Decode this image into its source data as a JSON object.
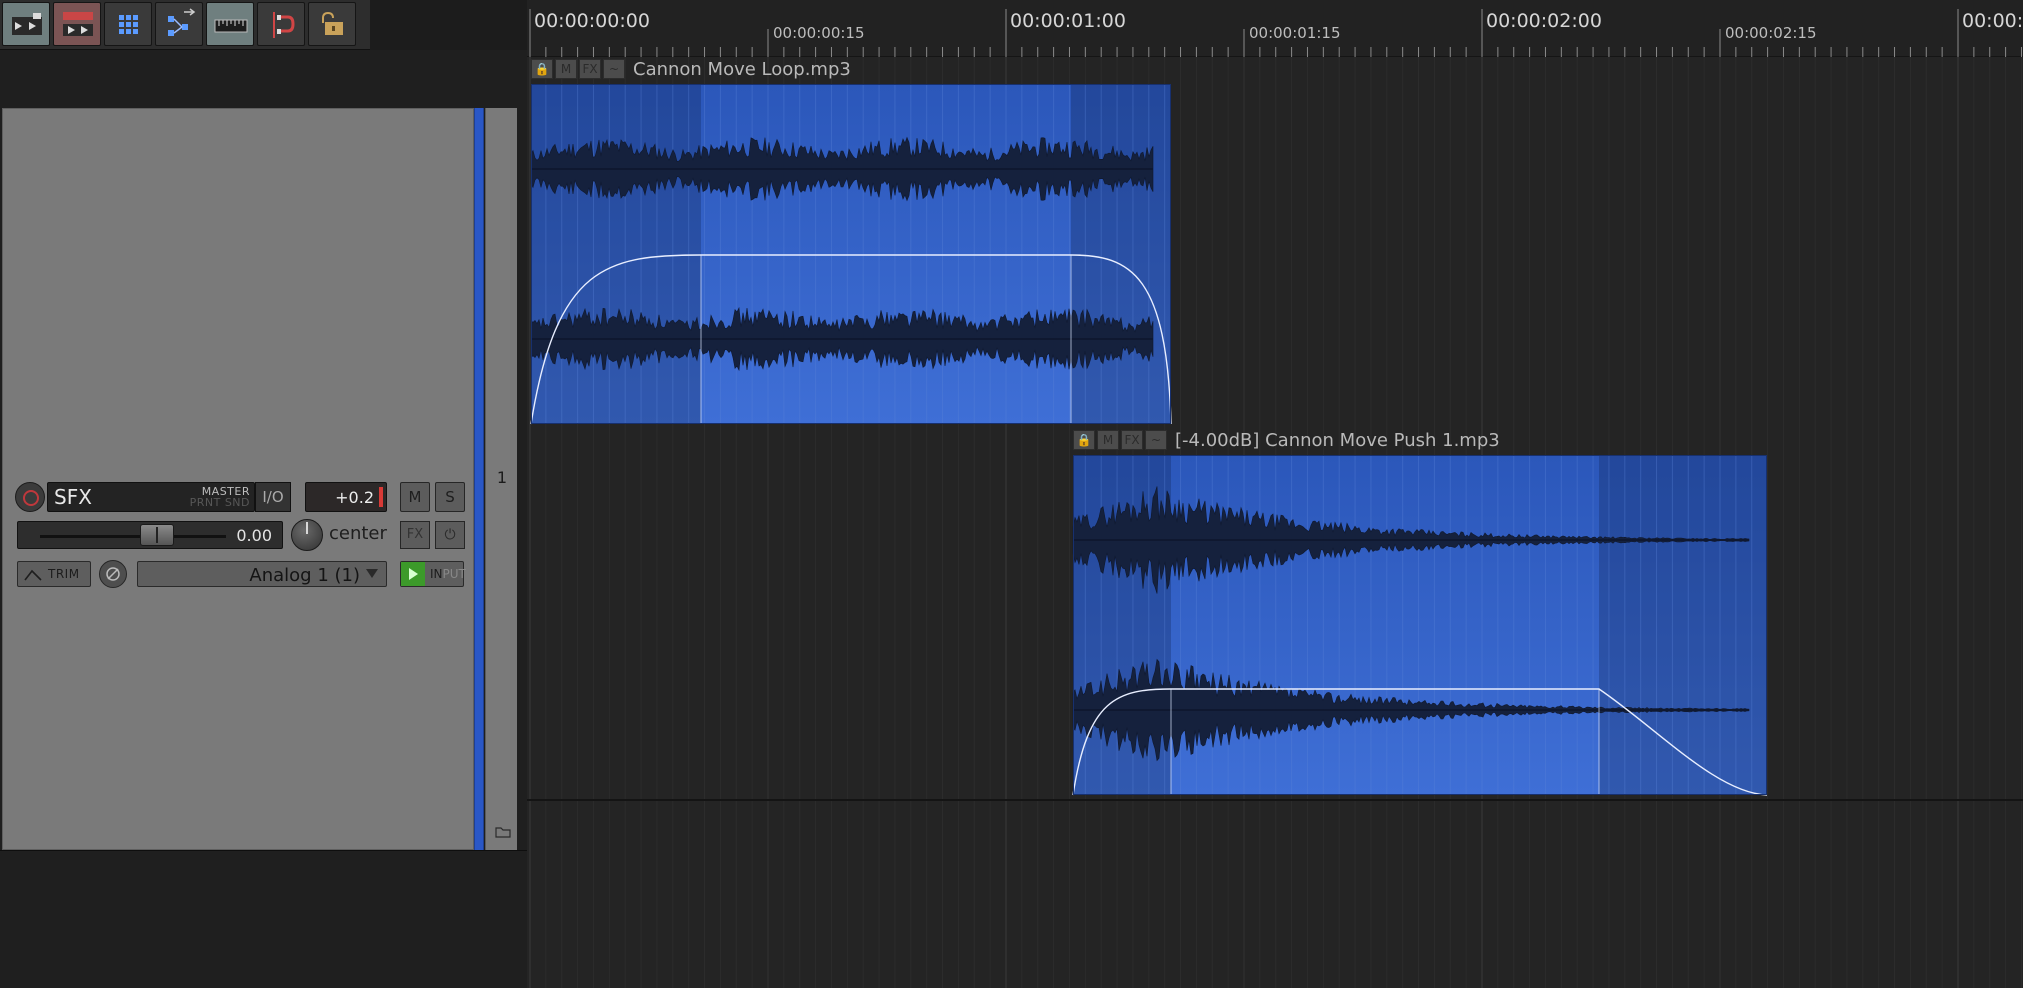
{
  "toolbar": {
    "buttons": [
      {
        "name": "auto-crossfade-button",
        "active": true
      },
      {
        "name": "ripple-edit-button",
        "active": true
      },
      {
        "name": "grid-button",
        "active": false
      },
      {
        "name": "routing-matrix-button",
        "active": false
      },
      {
        "name": "envelope-lock-button",
        "active": true
      },
      {
        "name": "snap-button",
        "active": false
      },
      {
        "name": "locking-button",
        "active": false
      }
    ]
  },
  "track": {
    "number": "1",
    "name": "SFX",
    "master_send_label": "MASTER",
    "master_send_sub": "PRNT SND",
    "io_label": "I/O",
    "volume_readout": "+0.2",
    "mute_label": "M",
    "solo_label": "S",
    "fader_value": "0.00",
    "pan_label": "center",
    "fx_label": "FX",
    "fx_bypass_label": "⏻",
    "trim_label": "TRIM",
    "input_label": "Analog 1 (1)",
    "monitor_label_on": "IN",
    "monitor_label_off": "PUT",
    "color": "#2a57c6"
  },
  "ruler": {
    "major_labels": [
      "00:00:00:00",
      "00:00:01:00",
      "00:00:02:00",
      "00:00:"
    ],
    "minor_labels": [
      "00:00:00:15",
      "00:00:01:15",
      "00:00:02:15"
    ]
  },
  "items": [
    {
      "name": "cannon-move-loop",
      "title": "Cannon Move Loop.mp3",
      "header_buttons": [
        "🔒",
        "M",
        "FX",
        "~"
      ]
    },
    {
      "name": "cannon-move-push",
      "title": "[-4.00dB] Cannon Move Push 1.mp3",
      "header_buttons": [
        "🔒",
        "M",
        "FX",
        "~"
      ]
    }
  ],
  "colors": {
    "item_blue": "#2f5fc6",
    "item_dark": "#24468f",
    "waveform": "#15213d"
  }
}
